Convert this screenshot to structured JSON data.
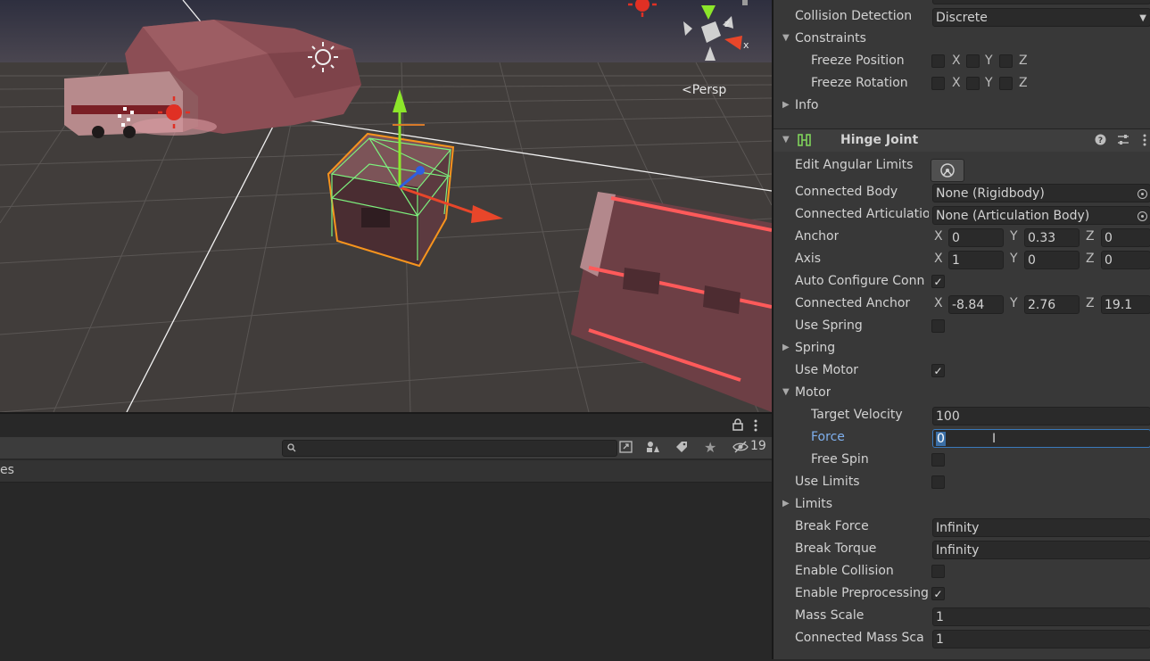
{
  "scene": {
    "persp_label": "Persp",
    "gizmo_axes": [
      "x",
      "y",
      "z"
    ]
  },
  "bottom_panel": {
    "header_partial": "es",
    "hidden_count": "19",
    "icons": [
      "lock-icon",
      "kebab-menu-icon",
      "search-icon",
      "scene-link-icon",
      "shapes-icon",
      "tag-icon",
      "star-icon",
      "eye-hidden-icon"
    ]
  },
  "inspector": {
    "collision_detection": {
      "label": "Collision Detection",
      "value": "Discrete"
    },
    "constraints": {
      "label": "Constraints",
      "freeze_position": {
        "label": "Freeze Position",
        "x": "X",
        "y": "Y",
        "z": "Z"
      },
      "freeze_rotation": {
        "label": "Freeze Rotation",
        "x": "X",
        "y": "Y",
        "z": "Z"
      }
    },
    "info": {
      "label": "Info"
    },
    "hinge_joint": {
      "title": "Hinge Joint",
      "edit_angular_limits": {
        "label": "Edit Angular Limits"
      },
      "connected_body": {
        "label": "Connected Body",
        "value": "None (Rigidbody)"
      },
      "connected_articulation": {
        "label": "Connected Articulatio",
        "value": "None (Articulation Body)"
      },
      "anchor": {
        "label": "Anchor",
        "x": "0",
        "y": "0.33",
        "z": "0"
      },
      "axis": {
        "label": "Axis",
        "x": "1",
        "y": "0",
        "z": "0"
      },
      "auto_configure": {
        "label": "Auto Configure Conn",
        "checked": true
      },
      "connected_anchor": {
        "label": "Connected Anchor",
        "x": "-8.84",
        "y": "2.76",
        "z": "19.1"
      },
      "use_spring": {
        "label": "Use Spring",
        "checked": false
      },
      "spring": {
        "label": "Spring"
      },
      "use_motor": {
        "label": "Use Motor",
        "checked": true
      },
      "motor": {
        "label": "Motor",
        "target_velocity": {
          "label": "Target Velocity",
          "value": "100"
        },
        "force": {
          "label": "Force",
          "value": "0"
        },
        "free_spin": {
          "label": "Free Spin",
          "checked": false
        }
      },
      "use_limits": {
        "label": "Use Limits",
        "checked": false
      },
      "limits": {
        "label": "Limits"
      },
      "break_force": {
        "label": "Break Force",
        "value": "Infinity"
      },
      "break_torque": {
        "label": "Break Torque",
        "value": "Infinity"
      },
      "enable_collision": {
        "label": "Enable Collision",
        "checked": false
      },
      "enable_preprocessing": {
        "label": "Enable Preprocessing",
        "checked": true
      },
      "mass_scale": {
        "label": "Mass Scale",
        "value": "1"
      },
      "connected_mass_scale": {
        "label": "Connected Mass Sca",
        "value": "1"
      }
    },
    "axis_labels": {
      "x": "X",
      "y": "Y",
      "z": "Z"
    },
    "colors": {
      "accent_blue": "#3a79bb",
      "label_blue": "#7fb0ee",
      "selection_orange": "#f7941d"
    }
  }
}
